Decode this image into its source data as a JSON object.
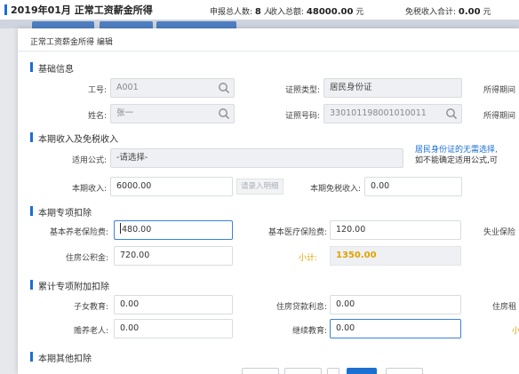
{
  "header": {
    "title": "2019年01月 正常工资薪金所得",
    "count_label": "申报总人数:",
    "count_value": "8",
    "count_unit": "人",
    "income_label": "收入总额:",
    "income_value": "48000.00",
    "income_unit": "元",
    "exempt_label": "免税收入合计:",
    "exempt_value": "0.00",
    "exempt_unit": "元"
  },
  "dialog": {
    "title": "正常工资薪金所得 编辑",
    "sections": {
      "basic": "基础信息",
      "income": "本期收入及免税收入",
      "special": "本期专项扣除",
      "additional": "累计专项附加扣除",
      "other": "本期其他扣除"
    },
    "basic": {
      "employee_id_label": "工号:",
      "employee_id_value": "A001",
      "id_type_label": "证照类型:",
      "id_type_value": "居民身份证",
      "period_label": "所得期间",
      "name_label": "姓名:",
      "name_value": "张一",
      "id_number_label": "证照号码:",
      "id_number_value": "330101198001010011",
      "period_label_2": "所得期间"
    },
    "income": {
      "formula_label": "适用公式:",
      "formula_value": "-请选择-",
      "hint_line1": "居民身份证的无需选择,",
      "hint_line2": "如不能确定适用公式,可",
      "current_income_label": "本期收入:",
      "current_income_value": "6000.00",
      "detail_button": "请录入明细",
      "exempt_label": "本期免税收入:",
      "exempt_value": "0.00"
    },
    "special": {
      "pension_label": "基本养老保险费:",
      "pension_value": "480.00",
      "medical_label": "基本医疗保险费:",
      "medical_value": "120.00",
      "unemployment_label": "失业保险",
      "housing_fund_label": "住房公积金:",
      "housing_fund_value": "720.00",
      "subtotal_label": "小计:",
      "subtotal_value": "1350.00"
    },
    "additional": {
      "education_label": "子女教育:",
      "education_value": "0.00",
      "mortgage_label": "住房贷款利息:",
      "mortgage_value": "0.00",
      "rent_label": "住房租",
      "elderly_label": "赡养老人:",
      "elderly_value": "0.00",
      "continuing_label": "继续教育:",
      "continuing_value": "0.00",
      "cut_label": "小"
    }
  },
  "colors": {
    "accent": "#1a6fd1",
    "subtotal": "#e0a300",
    "hint": "#1a6fd1"
  }
}
